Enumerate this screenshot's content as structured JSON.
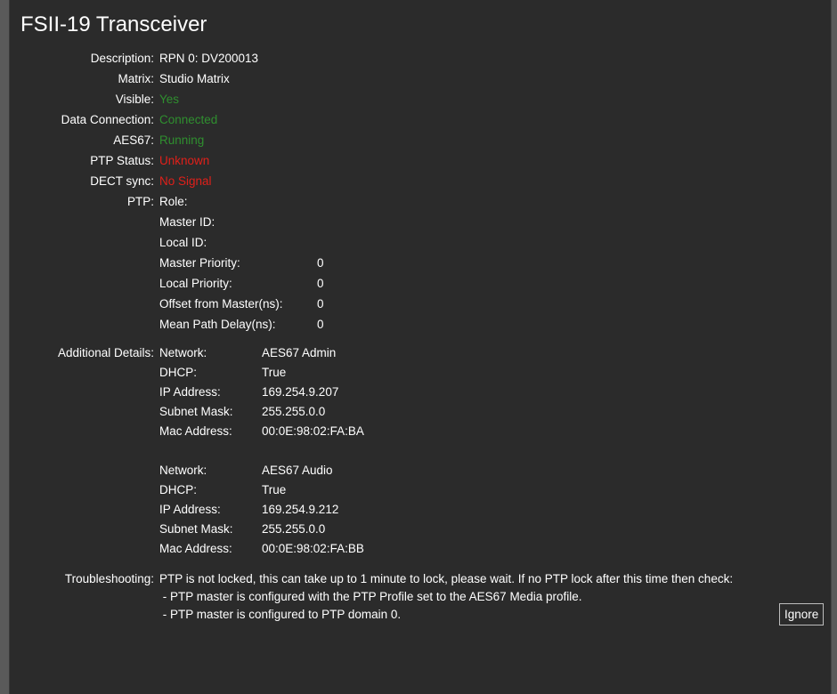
{
  "title": "FSII-19 Transceiver",
  "fields": {
    "description": {
      "label": "Description:",
      "value": "RPN 0: DV200013"
    },
    "matrix": {
      "label": "Matrix:",
      "value": "Studio Matrix"
    },
    "visible": {
      "label": "Visible:",
      "value": "Yes"
    },
    "data_connection": {
      "label": "Data Connection:",
      "value": "Connected"
    },
    "aes67": {
      "label": "AES67:",
      "value": "Running"
    },
    "ptp_status": {
      "label": "PTP Status:",
      "value": "Unknown"
    },
    "dect_sync": {
      "label": "DECT sync:",
      "value": "No Signal"
    }
  },
  "status_colors": {
    "ok": "#2f8f2f",
    "error": "#e0201a"
  },
  "ptp": {
    "label": "PTP:",
    "items": [
      {
        "label": "Role:",
        "value": ""
      },
      {
        "label": "Master ID:",
        "value": ""
      },
      {
        "label": "Local ID:",
        "value": ""
      },
      {
        "label": "Master Priority:",
        "value": "0"
      },
      {
        "label": "Local Priority:",
        "value": "0"
      },
      {
        "label": "Offset from Master(ns):",
        "value": "0"
      },
      {
        "label": "Mean Path Delay(ns):",
        "value": "0"
      }
    ]
  },
  "additional_details": {
    "label": "Additional Details:",
    "networks": [
      {
        "rows": [
          {
            "label": "Network:",
            "value": "AES67 Admin"
          },
          {
            "label": "DHCP:",
            "value": "True"
          },
          {
            "label": "IP Address:",
            "value": "169.254.9.207"
          },
          {
            "label": "Subnet Mask:",
            "value": "255.255.0.0"
          },
          {
            "label": "Mac Address:",
            "value": "00:0E:98:02:FA:BA"
          }
        ]
      },
      {
        "rows": [
          {
            "label": "Network:",
            "value": "AES67 Audio"
          },
          {
            "label": "DHCP:",
            "value": "True"
          },
          {
            "label": "IP Address:",
            "value": "169.254.9.212"
          },
          {
            "label": "Subnet Mask:",
            "value": "255.255.0.0"
          },
          {
            "label": "Mac Address:",
            "value": "00:0E:98:02:FA:BB"
          }
        ]
      }
    ]
  },
  "troubleshooting": {
    "label": "Troubleshooting:",
    "lines": [
      "PTP is not locked, this can take up to 1 minute to lock, please wait. If no PTP lock after this time then check:",
      " - PTP master is configured with the PTP Profile set to the AES67 Media profile.",
      " - PTP master is configured to PTP domain 0."
    ]
  },
  "ignore_label": "Ignore"
}
